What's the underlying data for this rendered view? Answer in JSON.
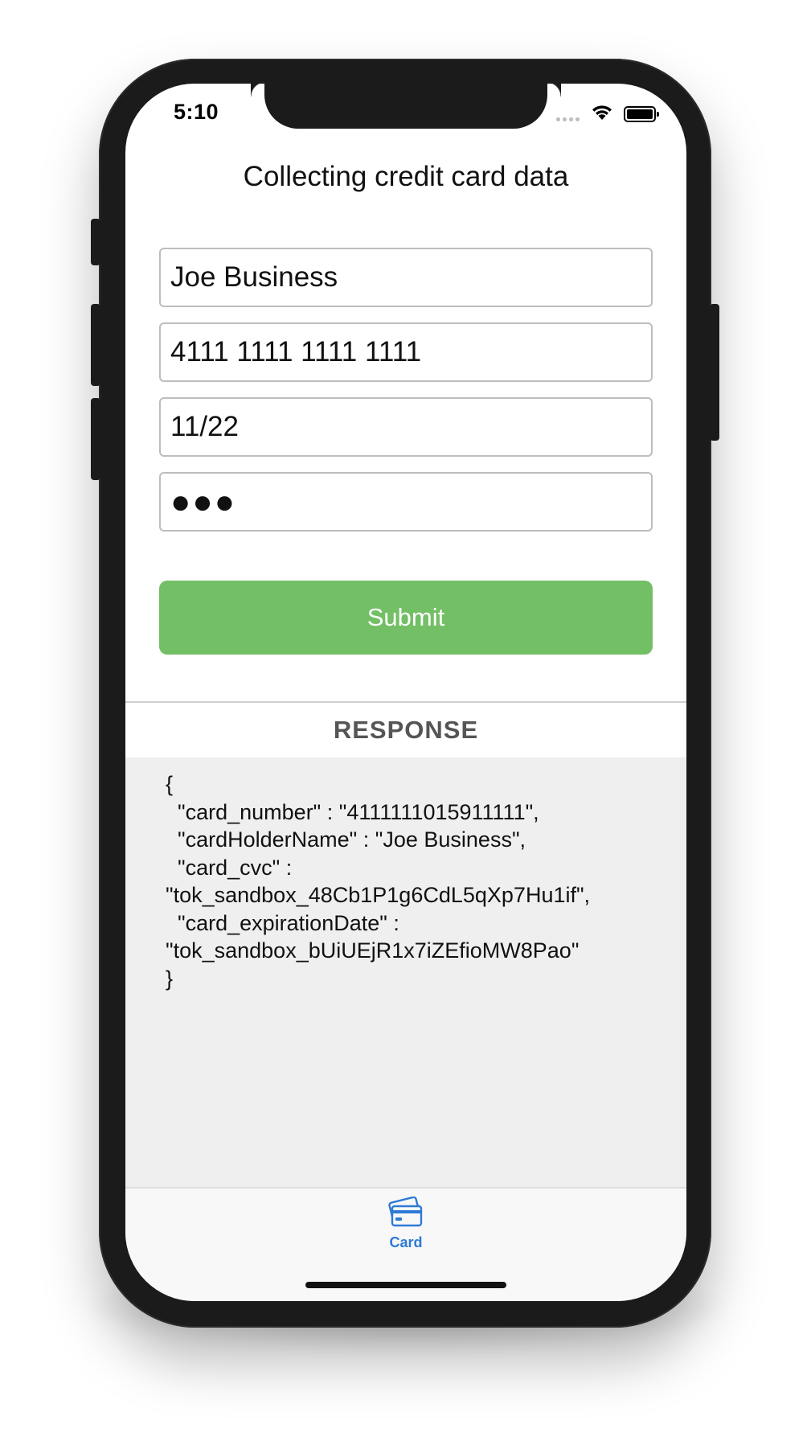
{
  "status_bar": {
    "time": "5:10"
  },
  "screen": {
    "title": "Collecting credit card data"
  },
  "form": {
    "cardholder_name": "Joe Business",
    "card_number": "4111 1111 1111 1111",
    "expiration": "11/22",
    "cvc_masked": "●●●",
    "submit_label": "Submit"
  },
  "response": {
    "heading": "RESPONSE",
    "body": "{\n  \"card_number\" : \"4111111015911111\",\n  \"cardHolderName\" : \"Joe Business\",\n  \"card_cvc\" :\n\"tok_sandbox_48Cb1P1g6CdL5qXp7Hu1if\",\n  \"card_expirationDate\" :\n\"tok_sandbox_bUiUEjR1x7iZEfioMW8Pao\"\n}"
  },
  "tab_bar": {
    "items": [
      {
        "label": "Card",
        "icon": "credit-card-icon",
        "active": true
      }
    ]
  },
  "colors": {
    "submit": "#73bf65",
    "tab_active": "#2e7ad7",
    "response_bg": "#efefef"
  }
}
